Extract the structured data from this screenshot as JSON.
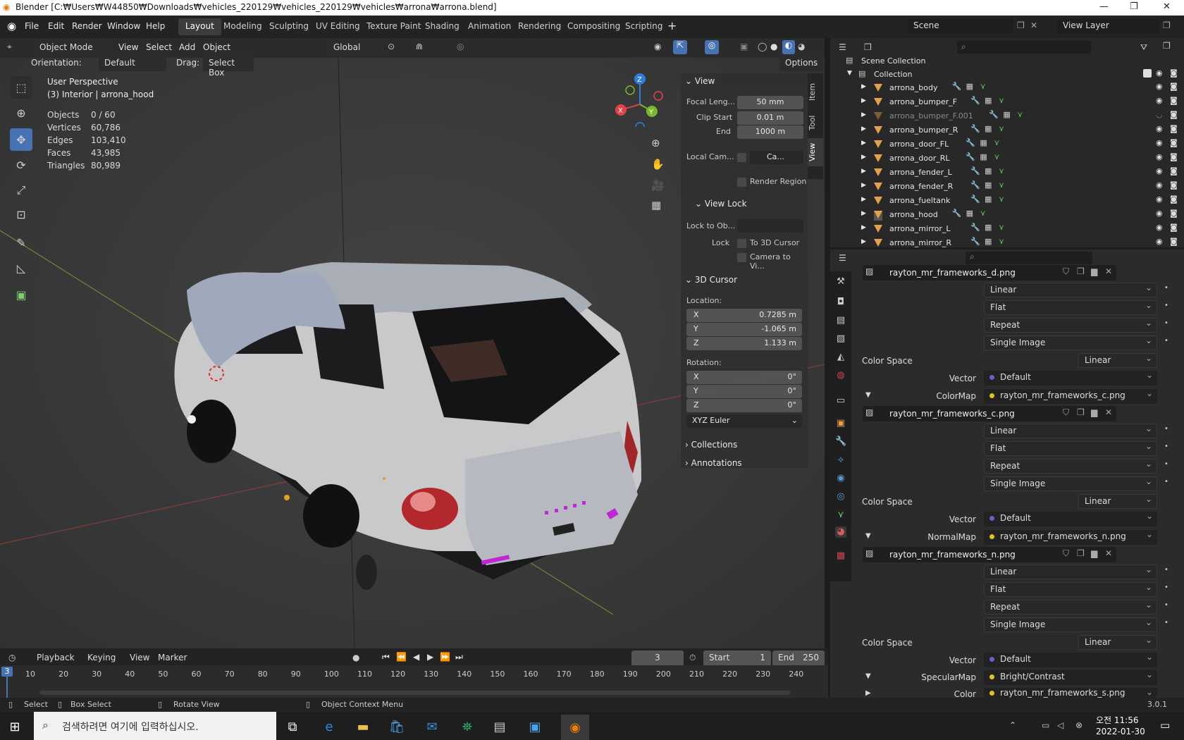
{
  "window": {
    "title": "Blender [C:₩Users₩W44850₩Downloads₩vehicles_220129₩vehicles_220129₩vehicles₩arrona₩arrona.blend]"
  },
  "menu": [
    "File",
    "Edit",
    "Render",
    "Window",
    "Help"
  ],
  "workspaces": [
    "Layout",
    "Modeling",
    "Sculpting",
    "UV Editing",
    "Texture Paint",
    "Shading",
    "Animation",
    "Rendering",
    "Compositing",
    "Scripting"
  ],
  "scene": {
    "label": "Scene",
    "view_layer": "View Layer"
  },
  "header3d": {
    "mode": "Object Mode",
    "menus": [
      "View",
      "Select",
      "Add",
      "Object"
    ],
    "transform": "Global",
    "orientation_label": "Orientation:",
    "orientation_value": "Default",
    "drag_label": "Drag:",
    "drag_value": "Select Box",
    "options": "Options"
  },
  "viewport": {
    "perspective": "User Perspective",
    "context": "(3) Interior | arrona_hood",
    "stats": [
      {
        "label": "Objects",
        "value": "0 / 60"
      },
      {
        "label": "Vertices",
        "value": "60,786"
      },
      {
        "label": "Edges",
        "value": "103,410"
      },
      {
        "label": "Faces",
        "value": "43,985"
      },
      {
        "label": "Triangles",
        "value": "80,989"
      }
    ],
    "gizmo": {
      "x": "X",
      "y": "Y",
      "z": "Z"
    }
  },
  "npanel": {
    "tabs": [
      "Item",
      "Tool",
      "View"
    ],
    "view_header": "View",
    "focal_label": "Focal Leng...",
    "focal_value": "50 mm",
    "clip_start_label": "Clip Start",
    "clip_start_value": "0.01 m",
    "end_label": "End",
    "end_value": "1000 m",
    "local_cam_label": "Local Cam...",
    "local_cam_value": "Ca...",
    "render_region": "Render Region",
    "view_lock_header": "View Lock",
    "lock_to_obj_label": "Lock to Ob...",
    "lock_label": "Lock",
    "to_3d_cursor": "To 3D Cursor",
    "camera_to_view": "Camera to Vi...",
    "cursor_header": "3D Cursor",
    "location_label": "Location:",
    "loc_x": "0.7285 m",
    "loc_y": "-1.065 m",
    "loc_z": "1.133 m",
    "rotation_label": "Rotation:",
    "rot_x": "0°",
    "rot_y": "0°",
    "rot_z": "0°",
    "axis_x": "X",
    "axis_y": "Y",
    "axis_z": "Z",
    "rotation_mode": "XYZ Euler",
    "collections": "Collections",
    "annotations": "Annotations"
  },
  "outliner": {
    "scene_collection": "Scene Collection",
    "collection": "Collection",
    "items": [
      "arrona_body",
      "arrona_bumper_F",
      "arrona_bumper_F.001",
      "arrona_bumper_R",
      "arrona_door_FL",
      "arrona_door_RL",
      "arrona_fender_L",
      "arrona_fender_R",
      "arrona_fueltank",
      "arrona_hood",
      "arrona_mirror_L",
      "arrona_mirror_R"
    ]
  },
  "properties": {
    "image1": "rayton_mr_frameworks_d.png",
    "image2": "rayton_mr_frameworks_c.png",
    "image3": "rayton_mr_frameworks_n.png",
    "interp": "Linear",
    "projection": "Flat",
    "extension": "Repeat",
    "source": "Single Image",
    "color_space_label": "Color Space",
    "color_space": "Linear",
    "vector_label": "Vector",
    "vector_value": "Default",
    "colormap_label": "ColorMap",
    "colormap_value": "rayton_mr_frameworks_c.png",
    "normalmap_label": "NormalMap",
    "normalmap_value": "rayton_mr_frameworks_n.png",
    "specularmap_label": "SpecularMap",
    "specularmap_value": "Bright/Contrast",
    "color_label": "Color",
    "color_value": "rayton_mr_frameworks_s.png"
  },
  "timeline": {
    "menus": [
      "Playback",
      "Keying",
      "View",
      "Marker"
    ],
    "current_frame": "3",
    "start_label": "Start",
    "start_value": "1",
    "end_label": "End",
    "end_value": "250",
    "ticks": [
      "10",
      "20",
      "30",
      "40",
      "50",
      "60",
      "70",
      "80",
      "90",
      "100",
      "110",
      "120",
      "130",
      "140",
      "150",
      "160",
      "170",
      "180",
      "190",
      "200",
      "210",
      "220",
      "230",
      "240"
    ]
  },
  "status": {
    "select": "Select",
    "box_select": "Box Select",
    "rotate_view": "Rotate View",
    "context_menu": "Object Context Menu",
    "version": "3.0.1"
  },
  "taskbar": {
    "search_placeholder": "검색하려면 여기에 입력하십시오.",
    "time": "오전 11:56",
    "date": "2022-01-30"
  }
}
